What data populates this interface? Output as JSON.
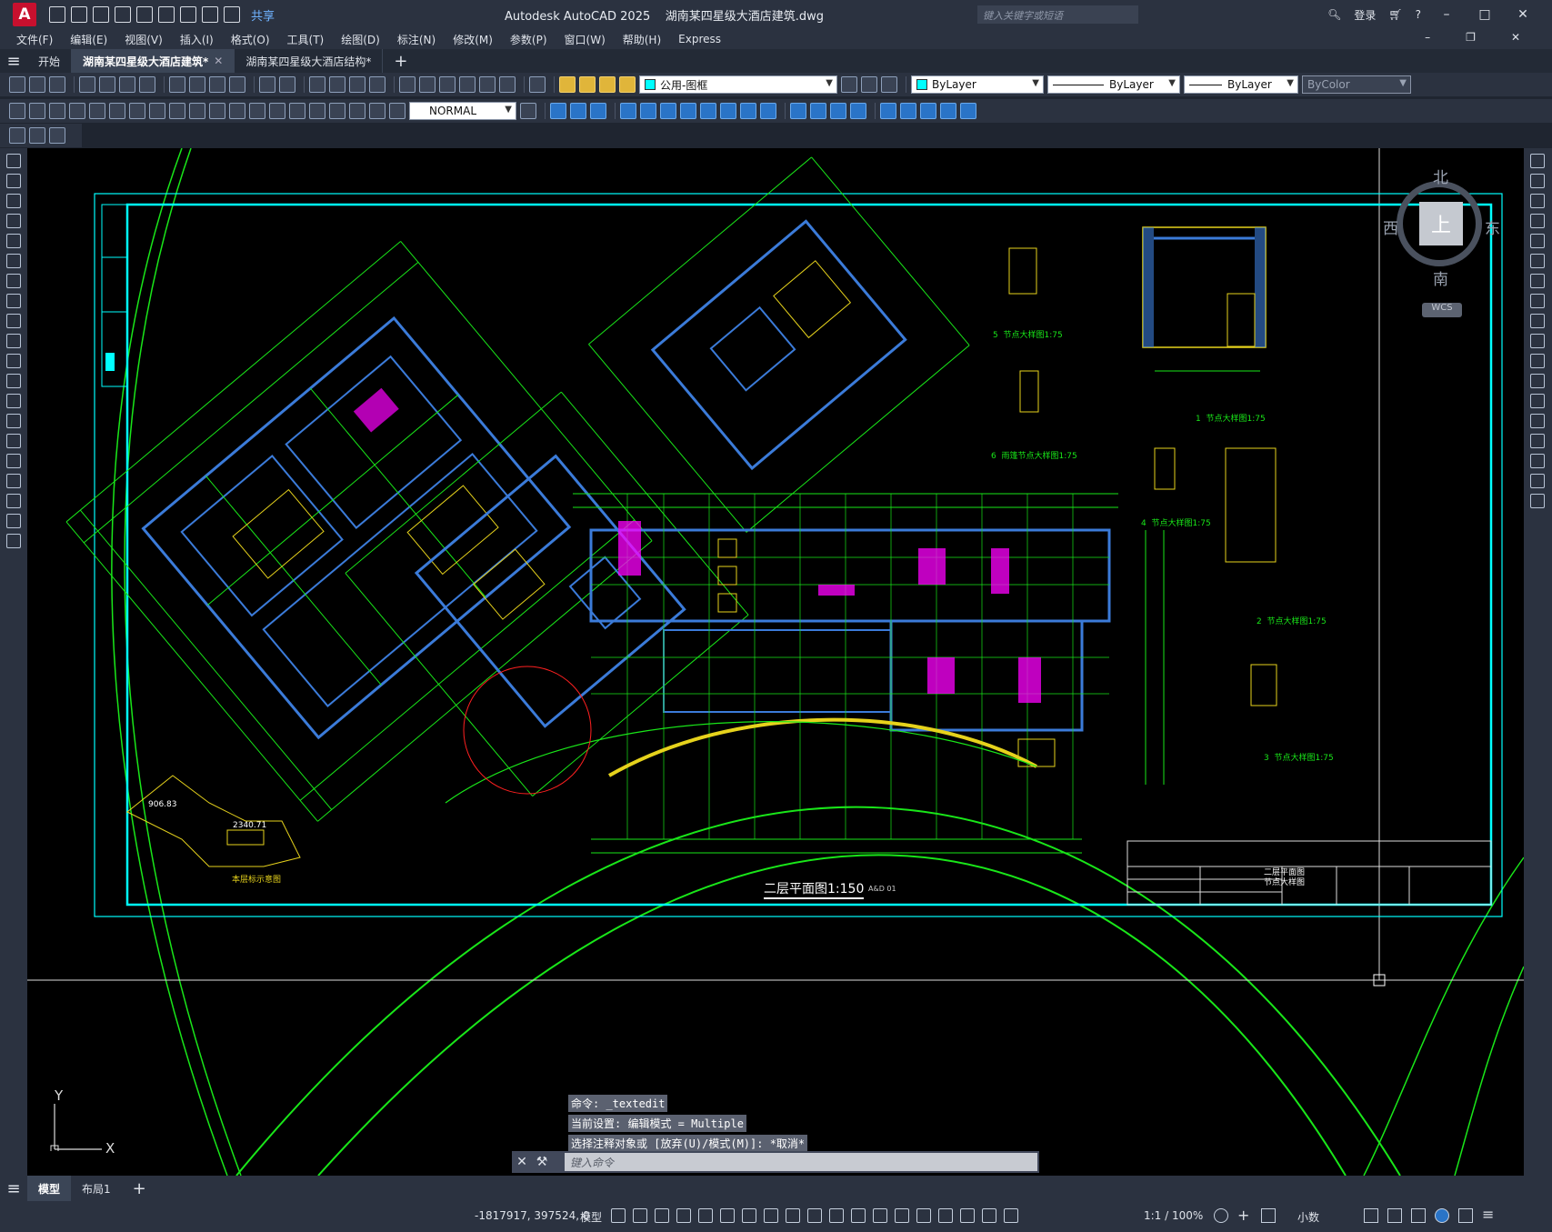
{
  "app": {
    "title": "Autodesk AutoCAD 2025",
    "document": "湖南某四星级大酒店建筑.dwg",
    "logo_letter": "A"
  },
  "quick_access": {
    "share_label": "共享"
  },
  "search": {
    "placeholder": "键入关键字或短语"
  },
  "account": {
    "login_label": "登录"
  },
  "menu": {
    "items": [
      "文件(F)",
      "编辑(E)",
      "视图(V)",
      "插入(I)",
      "格式(O)",
      "工具(T)",
      "绘图(D)",
      "标注(N)",
      "修改(M)",
      "参数(P)",
      "窗口(W)",
      "帮助(H)",
      "Express"
    ]
  },
  "tabs": {
    "items": [
      {
        "label": "开始"
      },
      {
        "label": "湖南某四星级大酒店建筑*"
      },
      {
        "label": "湖南某四星级大酒店结构*"
      }
    ],
    "active_index": 1
  },
  "toolbar": {
    "dim_style": "NORMAL",
    "layer": "公用-图框",
    "color": "ByLayer",
    "linetype": "ByLayer",
    "lineweight": "ByLayer",
    "plot_style": "ByColor"
  },
  "drawing": {
    "title_main": "二层平面图1:150",
    "title_small": "A&D 01",
    "site_note": "本层标示意图",
    "site_values": [
      "906.83",
      "2340.71"
    ],
    "detail_labels": [
      "节点大样图1:75",
      "雨篷节点大样图1:75",
      "节点大样图1:75",
      "节点大样图1:75",
      "节点大样图1:75",
      "节点大样图1:75"
    ],
    "detail_numbers": [
      "5",
      "6",
      "1",
      "4",
      "2",
      "3"
    ],
    "title_block": [
      "二层平面图",
      "节点大样图"
    ]
  },
  "viewcube": {
    "north": "北",
    "south": "南",
    "east": "东",
    "west": "西",
    "top": "上",
    "wcs": "WCS"
  },
  "ucs": {
    "x": "X",
    "y": "Y"
  },
  "command": {
    "history": [
      "命令: _textedit",
      "当前设置: 编辑模式 = Multiple",
      "选择注释对象或 [放弃(U)/模式(M)]: *取消*"
    ],
    "placeholder": "键入命令"
  },
  "layouts": {
    "items": [
      "模型",
      "布局1"
    ],
    "active_index": 0
  },
  "status": {
    "coords": "-1817917, 397524, 0",
    "mode": "模型",
    "scale": "1:1 / 100%",
    "units": "小数"
  },
  "colors": {
    "accent": "#00ffff",
    "plan_green": "#19e619",
    "plan_blue": "#3b7bd9",
    "plan_yellow": "#e6d21c",
    "plan_magenta": "#ff00ff",
    "plan_red": "#ff2020"
  }
}
